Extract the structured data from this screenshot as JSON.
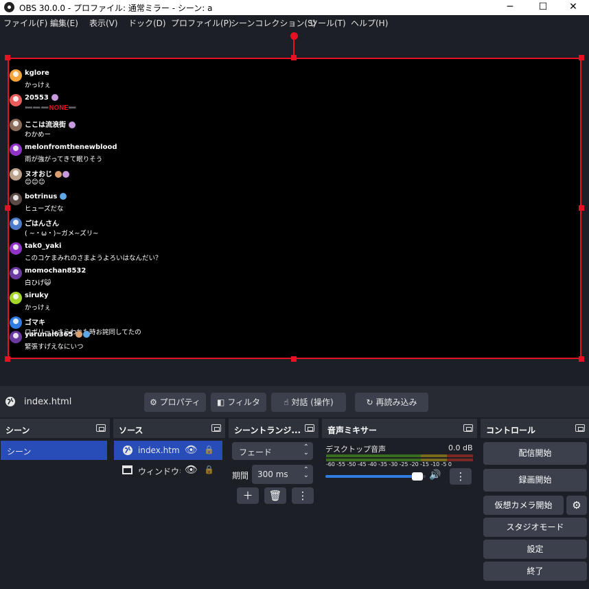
{
  "window": {
    "title": "OBS 30.0.0 - プロファイル: 通常ミラー - シーン: a",
    "minimize": "─",
    "maximize": "☐",
    "close": "✕"
  },
  "menu": [
    "ファイル(F)",
    "編集(E)",
    "表示(V)",
    "ドック(D)",
    "プロファイル(P)",
    "シーンコレクション(S)",
    "ツール(T)",
    "ヘルプ(H)"
  ],
  "chat": [
    {
      "name": "kglore",
      "text": "かっけぇ",
      "color": "#f2a33a"
    },
    {
      "name": "20553",
      "text": "➖➖➖𝐍𝐎𝐍𝐄➖",
      "color": "#e85c5c"
    },
    {
      "name": "ここは流浪街",
      "text": "わかめー",
      "color": "#8a6b5a"
    },
    {
      "name": "melonfromthenewblood",
      "text": "雨が強がってきて眠りそう",
      "color": "#8e34c7"
    },
    {
      "name": "ヌオおじ",
      "text": "😊😊😊",
      "color": "#b9a08a"
    },
    {
      "name": "botrinus",
      "text": "ヒューズだな",
      "color": "#5a4a48"
    },
    {
      "name": "ごはんさん",
      "text": "( ~・ω・)~ガメ~ズリ~",
      "color": "#4a7ac8"
    },
    {
      "name": "tak0_yaki",
      "text": "このコケまみれのさまようよろいはなんだい？",
      "color": "#8e34c7"
    },
    {
      "name": "momochan8532",
      "text": "白ひげ😺",
      "color": "#6b3aa0"
    },
    {
      "name": "siruky",
      "text": "かっけぇ",
      "color": "#a4d62a"
    },
    {
      "name": "ゴマキ",
      "text": "ロボリーンさらわれた時お詫同してたの",
      "color": "#2f7de0"
    },
    {
      "name": "yarunal6365",
      "text": "緊張すげえなにいつ",
      "color": "#6b3aa0"
    }
  ],
  "context": {
    "source_name": "index.html",
    "properties": "プロパティ",
    "filters": "フィルタ",
    "interact": "対話 (操作)",
    "refresh": "再読み込み"
  },
  "scenes": {
    "title": "シーン",
    "items": [
      "シーン"
    ]
  },
  "sources": {
    "title": "ソース",
    "items": [
      "index.htm",
      "ウィンドウキ"
    ]
  },
  "transitions": {
    "title": "シーントランジ...",
    "selected": "フェード",
    "duration_label": "期間",
    "duration": "300 ms"
  },
  "mixer": {
    "title": "音声ミキサー",
    "channel": "デスクトップ音声",
    "level": "0.0 dB",
    "scale": [
      "-60",
      "-55",
      "-50",
      "-45",
      "-40",
      "-35",
      "-30",
      "-25",
      "-20",
      "-15",
      "-10",
      "-5",
      "0"
    ],
    "volume_fraction": 0.97
  },
  "controls": {
    "title": "コントロール",
    "start_stream": "配信開始",
    "start_record": "録画開始",
    "virtual_cam": "仮想カメラ開始",
    "studio": "スタジオモード",
    "settings": "設定",
    "exit": "終了"
  },
  "colors": {
    "accent": "#284cb8",
    "selection": "#e81123",
    "bg": "#1d1f26"
  }
}
